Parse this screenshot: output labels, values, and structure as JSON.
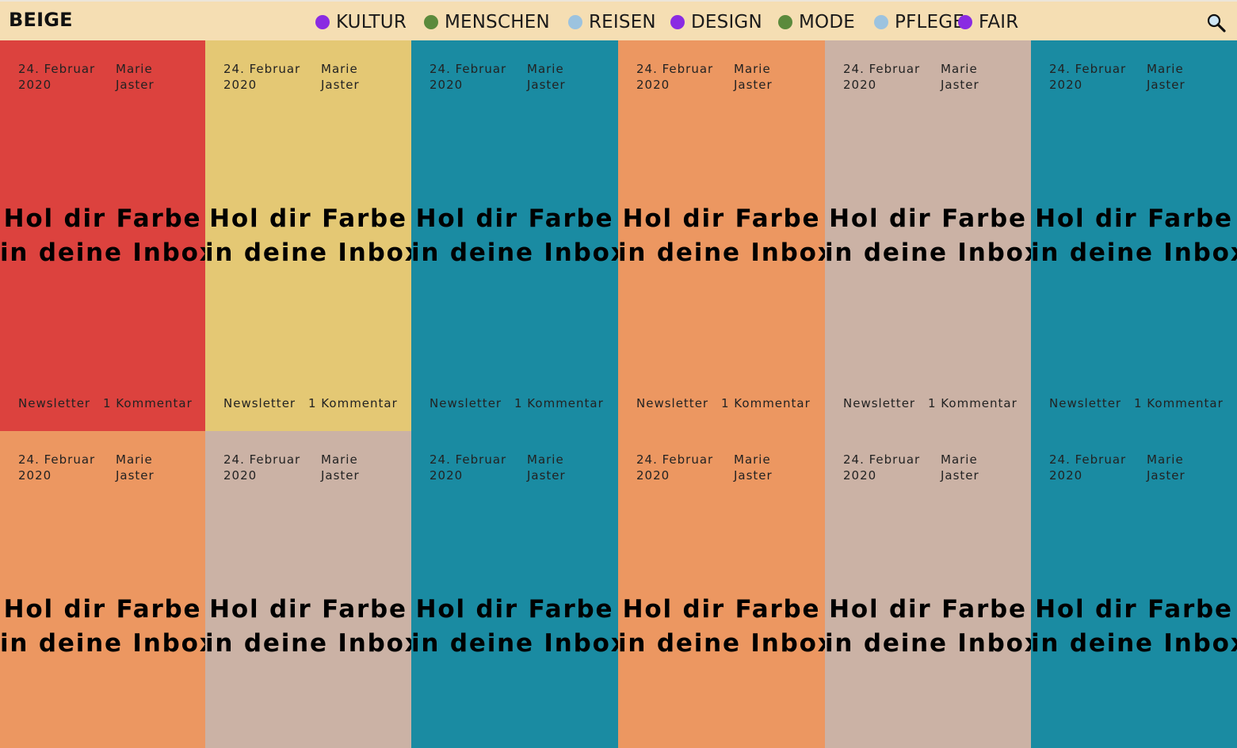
{
  "header": {
    "logo": "BEIGE",
    "nav": [
      {
        "label": "KULTUR",
        "color": "#8a2be2"
      },
      {
        "label": "MENSCHEN",
        "color": "#5b8a3c"
      },
      {
        "label": "REISEN",
        "color": "#9cc3df"
      },
      {
        "label": "DESIGN",
        "color": "#8a2be2"
      },
      {
        "label": "MODE",
        "color": "#5b8a3c"
      },
      {
        "label": "PFLEGE",
        "color": "#9cc3df"
      },
      {
        "label": "FAIR",
        "color": "#8a2be2"
      }
    ],
    "search_icon": "search-icon"
  },
  "posts": [
    {
      "date_line1": "24. Februar",
      "date_line2": "2020",
      "author_line1": "Marie",
      "author_line2": "Jaster",
      "title_line1": "Hol dir Farbe",
      "title_line2": "in deine Inbox",
      "category": "Newsletter",
      "comments": "1 Kommentar",
      "color": "#dc423e"
    },
    {
      "date_line1": "24. Februar",
      "date_line2": "2020",
      "author_line1": "Marie",
      "author_line2": "Jaster",
      "title_line1": "Hol dir Farbe",
      "title_line2": "in deine Inbox",
      "category": "Newsletter",
      "comments": "1 Kommentar",
      "color": "#e4c874"
    },
    {
      "date_line1": "24. Februar",
      "date_line2": "2020",
      "author_line1": "Marie",
      "author_line2": "Jaster",
      "title_line1": "Hol dir Farbe",
      "title_line2": "in deine Inbox",
      "category": "Newsletter",
      "comments": "1 Kommentar",
      "color": "#1a8ba2"
    },
    {
      "date_line1": "24. Februar",
      "date_line2": "2020",
      "author_line1": "Marie",
      "author_line2": "Jaster",
      "title_line1": "Hol dir Farbe",
      "title_line2": "in deine Inbox",
      "category": "Newsletter",
      "comments": "1 Kommentar",
      "color": "#ec9761"
    },
    {
      "date_line1": "24. Februar",
      "date_line2": "2020",
      "author_line1": "Marie",
      "author_line2": "Jaster",
      "title_line1": "Hol dir Farbe",
      "title_line2": "in deine Inbox",
      "category": "Newsletter",
      "comments": "1 Kommentar",
      "color": "#cbb2a5"
    },
    {
      "date_line1": "24. Februar",
      "date_line2": "2020",
      "author_line1": "Marie",
      "author_line2": "Jaster",
      "title_line1": "Hol dir Farbe",
      "title_line2": "in deine Inbox",
      "category": "Newsletter",
      "comments": "1 Kommentar",
      "color": "#1a8ba2"
    },
    {
      "date_line1": "24. Februar",
      "date_line2": "2020",
      "author_line1": "Marie",
      "author_line2": "Jaster",
      "title_line1": "Hol dir Farbe",
      "title_line2": "in deine Inbox",
      "color": "#ec9761"
    },
    {
      "date_line1": "24. Februar",
      "date_line2": "2020",
      "author_line1": "Marie",
      "author_line2": "Jaster",
      "title_line1": "Hol dir Farbe",
      "title_line2": "in deine Inbox",
      "color": "#cbb2a5"
    },
    {
      "date_line1": "24. Februar",
      "date_line2": "2020",
      "author_line1": "Marie",
      "author_line2": "Jaster",
      "title_line1": "Hol dir Farbe",
      "title_line2": "in deine Inbox",
      "color": "#1a8ba2"
    },
    {
      "date_line1": "24. Februar",
      "date_line2": "2020",
      "author_line1": "Marie",
      "author_line2": "Jaster",
      "title_line1": "Hol dir Farbe",
      "title_line2": "in deine Inbox",
      "color": "#ec9761"
    },
    {
      "date_line1": "24. Februar",
      "date_line2": "2020",
      "author_line1": "Marie",
      "author_line2": "Jaster",
      "title_line1": "Hol dir Farbe",
      "title_line2": "in deine Inbox",
      "color": "#cbb2a5"
    },
    {
      "date_line1": "24. Februar",
      "date_line2": "2020",
      "author_line1": "Marie",
      "author_line2": "Jaster",
      "title_line1": "Hol dir Farbe",
      "title_line2": "in deine Inbox",
      "color": "#1a8ba2"
    }
  ]
}
